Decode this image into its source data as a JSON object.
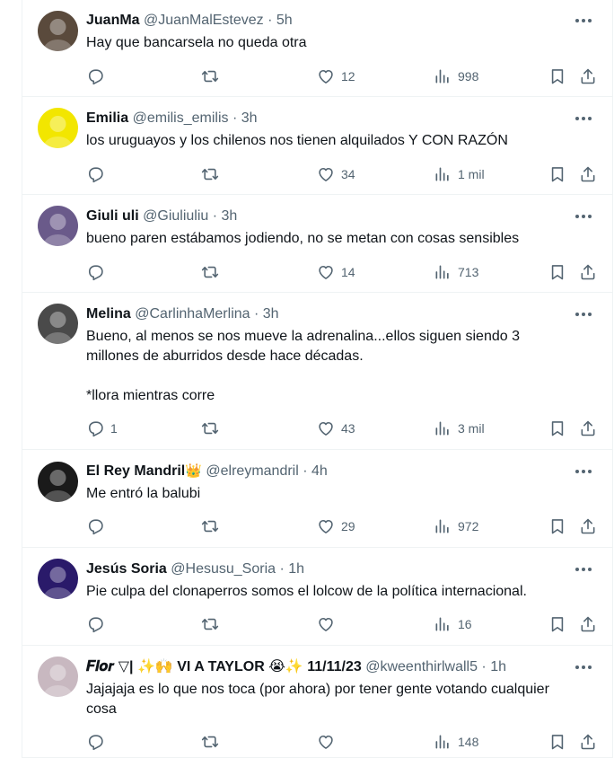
{
  "tweets": [
    {
      "name": "JuanMa",
      "handle": "@JuanMalEstevez",
      "dot": "·",
      "time": "5h",
      "text": "Hay que bancarsela no queda otra",
      "replies": "",
      "likes": "12",
      "views": "998",
      "avatar_color": "#5a4a3c"
    },
    {
      "name": "Emilia",
      "handle": "@emilis_emilis",
      "dot": "·",
      "time": "3h",
      "text": "los uruguayos y los chilenos nos tienen alquilados Y CON RAZÓN",
      "replies": "",
      "likes": "34",
      "views": "1 mil",
      "avatar_color": "#f2e600"
    },
    {
      "name": "Giuli uli",
      "handle": "@Giuliuliu",
      "dot": "·",
      "time": "3h",
      "text": "bueno paren estábamos jodiendo, no se metan con cosas sensibles",
      "replies": "",
      "likes": "14",
      "views": "713",
      "avatar_color": "#6a5a8a"
    },
    {
      "name": "Melina",
      "handle": "@CarlinhaMerlina",
      "dot": "·",
      "time": "3h",
      "text": "Bueno, al menos se nos mueve la adrenalina...ellos siguen siendo 3\nmillones de aburridos desde hace décadas.\n\n*llora mientras corre",
      "replies": "1",
      "likes": "43",
      "views": "3 mil",
      "avatar_color": "#4a4a4a"
    },
    {
      "name": "El Rey Mandril",
      "name_emoji": "👑",
      "handle": "@elreymandril",
      "dot": "·",
      "time": "4h",
      "text": "Me entró la balubi",
      "replies": "",
      "likes": "29",
      "views": "972",
      "avatar_color": "#1a1a1a"
    },
    {
      "name": "Jesús Soria",
      "handle": "@Hesusu_Soria",
      "dot": "·",
      "time": "1h",
      "text": "Pie culpa del clonaperros somos el lolcow de la política internacional.",
      "replies": "",
      "likes": "",
      "views": "16",
      "avatar_color": "#2a1a6a"
    },
    {
      "name": "𝑭𝒍𝒐𝒓 ▽| ✨🙌 VI A TAYLOR 😭✨ 11/11/23",
      "handle": "@kweenthirlwall5",
      "dot": "·",
      "time": "1h",
      "text": "Jajajaja es lo que nos toca (por ahora) por tener gente votando cualquier\ncosa",
      "replies": "",
      "likes": "",
      "views": "148",
      "avatar_color": "#c8b8c0"
    }
  ],
  "icons": {
    "reply": "reply-icon",
    "retweet": "retweet-icon",
    "like": "heart-icon",
    "views": "views-icon",
    "bookmark": "bookmark-icon",
    "share": "share-icon",
    "more": "more-icon"
  },
  "colors": {
    "text": "#0f1419",
    "secondary": "#536471",
    "border": "#eff3f4"
  }
}
